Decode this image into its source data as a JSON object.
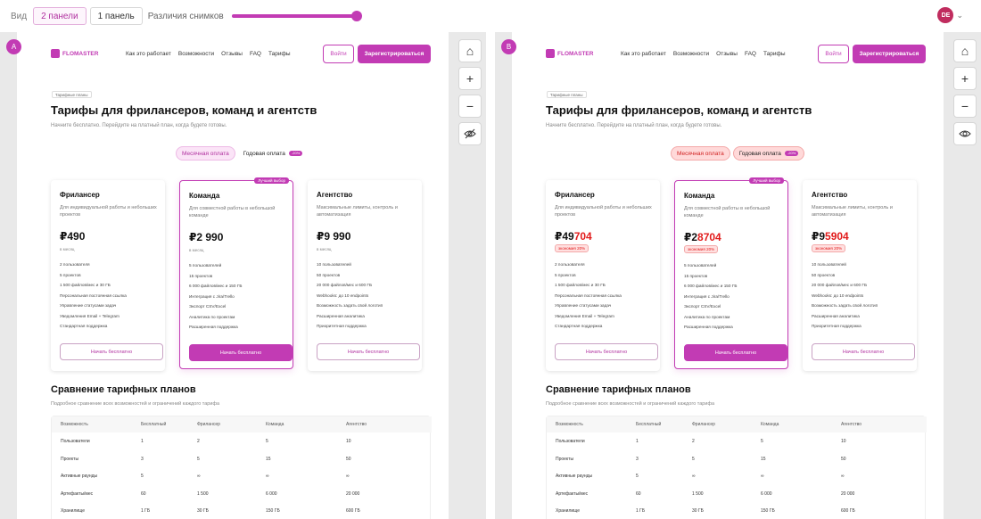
{
  "toolbar": {
    "view_label": "Вид",
    "two_panels": "2 панели",
    "one_panel": "1 панель",
    "diff_label": "Различия снимков",
    "diff_value": 1.0,
    "user_initials": "DE",
    "accent": "#c23bb4"
  },
  "panels": [
    {
      "badge": "A",
      "nav": {
        "logo": "FLOMASTER",
        "links": [
          "Как это работает",
          "Возможности",
          "Отзывы",
          "FAQ",
          "Тарифы"
        ],
        "login": "Войти",
        "register": "Зарегистрироваться"
      },
      "crumb": "Тарифные планы",
      "title": "Тарифы для фрилансеров, команд и агентств",
      "subtitle": "Начните бесплатно. Перейдите на платный план, когда будете готовы.",
      "toggle": {
        "monthly": "Месячная оплата",
        "yearly": "Годовая оплата",
        "discount": "-20%"
      },
      "cards": [
        {
          "name": "Фрилансер",
          "desc": "Для индивидуальной работы и небольших проектов",
          "price": "₽490",
          "period": "в месяц",
          "features": [
            "2 пользователя",
            "5 проектов",
            "1 500 файлов/мес и 30 ГБ",
            "Персональная постоянная ссылка",
            "Управление статусами задач",
            "Уведомления Email + Telegram",
            "Стандартная поддержка"
          ],
          "cta": "Начать бесплатно"
        },
        {
          "name": "Команда",
          "desc": "Для совместной работы в небольшой команде",
          "price": "₽2 990",
          "period": "в месяц",
          "ribbon": "Лучший выбор",
          "features": [
            "5 пользователей",
            "15 проектов",
            "6 000 файлов/мес и 150 ГБ",
            "Интеграция с Jira/Trello",
            "Экспорт CSV/Excel",
            "Аналитика по проектам",
            "Расширенная поддержка"
          ],
          "cta": "Начать бесплатно"
        },
        {
          "name": "Агентство",
          "desc": "Максимальные лимиты, контроль и автоматизация",
          "price": "₽9 990",
          "period": "в месяц",
          "features": [
            "10 пользователей",
            "50 проектов",
            "20 000 файлов/мес и 600 ГБ",
            "Webhooks: до 10 endpoints",
            "Возможность задать свой логотип",
            "Расширенная аналитика",
            "Приоритетная поддержка"
          ],
          "cta": "Начать бесплатно"
        }
      ],
      "compare_title": "Сравнение тарифных планов",
      "compare_sub": "Подробное сравнение всех возможностей и ограничений каждого тарифа",
      "table": {
        "headers": [
          "Возможность",
          "Бесплатный",
          "Фрилансер",
          "Команда",
          "Агентство"
        ],
        "rows": [
          [
            "Пользователи",
            "1",
            "2",
            "5",
            "10"
          ],
          [
            "Проекты",
            "3",
            "5",
            "15",
            "50"
          ],
          [
            "Активные раунды",
            "5",
            "∞",
            "∞",
            "∞"
          ],
          [
            "Артефакты/мес",
            "60",
            "1 500",
            "6 000",
            "20 000"
          ],
          [
            "Хранилище",
            "1 ГБ",
            "30 ГБ",
            "150 ГБ",
            "600 ГБ"
          ]
        ]
      }
    },
    {
      "badge": "B",
      "nav": {
        "logo": "FLOMASTER",
        "links": [
          "Как это работает",
          "Возможности",
          "Отзывы",
          "FAQ",
          "Тарифы"
        ],
        "login": "Войти",
        "register": "Зарегистрироваться"
      },
      "crumb": "Тарифные планы",
      "title": "Тарифы для фрилансеров, команд и агентств",
      "subtitle": "Начните бесплатно. Перейдите на платный план, когда будете готовы.",
      "toggle": {
        "monthly": "Месячная оплата",
        "yearly": "Годовая оплата",
        "discount": "-20%"
      },
      "cards": [
        {
          "name": "Фрилансер",
          "desc": "Для индивидуальной работы и небольших проектов",
          "price_old": "₽49",
          "price_new": "704",
          "save": "экономия 20%",
          "features": [
            "2 пользователя",
            "5 проектов",
            "1 500 файлов/мес и 30 ГБ",
            "Персональная постоянная ссылка",
            "Управление статусами задач",
            "Уведомления Email + Telegram",
            "Стандартная поддержка"
          ],
          "cta": "Начать бесплатно"
        },
        {
          "name": "Команда",
          "desc": "Для совместной работы в небольшой команде",
          "price_old": "₽2",
          "price_new": "8704",
          "save": "экономия 20%",
          "ribbon": "Лучший выбор",
          "features": [
            "5 пользователей",
            "15 проектов",
            "6 000 файлов/мес и 150 ГБ",
            "Интеграция с Jira/Trello",
            "Экспорт CSV/Excel",
            "Аналитика по проектам",
            "Расширенная поддержка"
          ],
          "cta": "Начать бесплатно"
        },
        {
          "name": "Агентство",
          "desc": "Максимальные лимиты, контроль и автоматизация",
          "price_old": "₽9",
          "price_new": "5904",
          "save": "экономия 20%",
          "features": [
            "10 пользователей",
            "50 проектов",
            "20 000 файлов/мес и 600 ГБ",
            "Webhooks: до 10 endpoints",
            "Возможность задать свой логотип",
            "Расширенная аналитика",
            "Приоритетная поддержка"
          ],
          "cta": "Начать бесплатно"
        }
      ],
      "compare_title": "Сравнение тарифных планов",
      "compare_sub": "Подробное сравнение всех возможностей и ограничений каждого тарифа",
      "table": {
        "headers": [
          "Возможность",
          "Бесплатный",
          "Фрилансер",
          "Команда",
          "Агентство"
        ],
        "rows": [
          [
            "Пользователи",
            "1",
            "2",
            "5",
            "10"
          ],
          [
            "Проекты",
            "3",
            "5",
            "15",
            "50"
          ],
          [
            "Активные раунды",
            "5",
            "∞",
            "∞",
            "∞"
          ],
          [
            "Артефакты/мес",
            "60",
            "1 500",
            "6 000",
            "20 000"
          ],
          [
            "Хранилище",
            "1 ГБ",
            "30 ГБ",
            "150 ГБ",
            "600 ГБ"
          ]
        ]
      }
    }
  ]
}
